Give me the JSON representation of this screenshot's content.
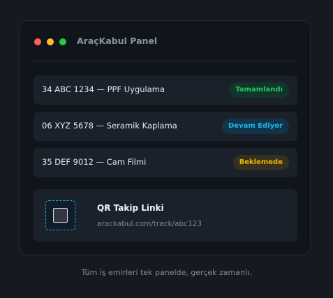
{
  "window": {
    "title": "AraçKabul Panel",
    "controls": [
      {
        "name": "close",
        "color": "#ff5f57"
      },
      {
        "name": "minimize",
        "color": "#febc2e"
      },
      {
        "name": "maximize",
        "color": "#28c840"
      }
    ]
  },
  "jobs": [
    {
      "text": "34 ABC 1234 — PPF Uygulama",
      "status": "Tamamlandı",
      "status_color": "#22c55e",
      "status_bg": "#12352a"
    },
    {
      "text": "06 XYZ 5678 — Seramik Kaplama",
      "status": "Devam Ediyor",
      "status_color": "#22b8e6",
      "status_bg": "#11344a"
    },
    {
      "text": "35 DEF 9012 — Cam Filmi",
      "status": "Beklemede",
      "status_color": "#eab308",
      "status_bg": "#343120"
    }
  ],
  "qr": {
    "icon": "qr-code-icon",
    "title": "QR Takip Linki",
    "link": "arackabul.com/track/abc123"
  },
  "caption": "Tüm iş emirleri tek panelde, gerçek zamanlı."
}
